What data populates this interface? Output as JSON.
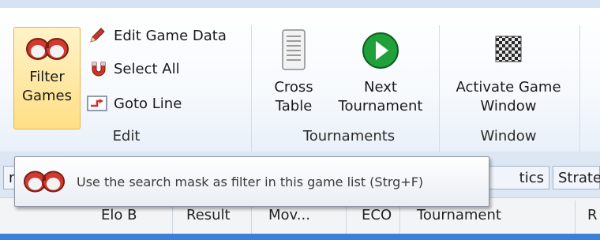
{
  "ribbon": {
    "edit_group": {
      "filter_games": [
        "Filter",
        "Games"
      ],
      "edit_game_data": "Edit Game Data",
      "select_all": "Select All",
      "goto_line": "Goto Line",
      "label": "Edit"
    },
    "tournaments_group": {
      "cross_table": [
        "Cross",
        "Table"
      ],
      "next_tournament": [
        "Next",
        "Tournament"
      ],
      "label": "Tournaments"
    },
    "window_group": {
      "activate_game_window": [
        "Activate Game",
        "Window"
      ],
      "label": "Window"
    }
  },
  "tabs": {
    "left_partial": "r",
    "statistics_partial": "tics",
    "strategy_partial": "Strate"
  },
  "table": {
    "columns": [
      "Elo B",
      "Result",
      "Mov...",
      "ECO",
      "Tournament",
      "R"
    ]
  },
  "tooltip": {
    "text": "Use the search mask as filter in this game list (Strg+F)"
  },
  "colors": {
    "selected_button_bg": "#ffdf86",
    "selection_bar": "#3d7ed8",
    "next_tournament_icon": "#1fa03a"
  }
}
